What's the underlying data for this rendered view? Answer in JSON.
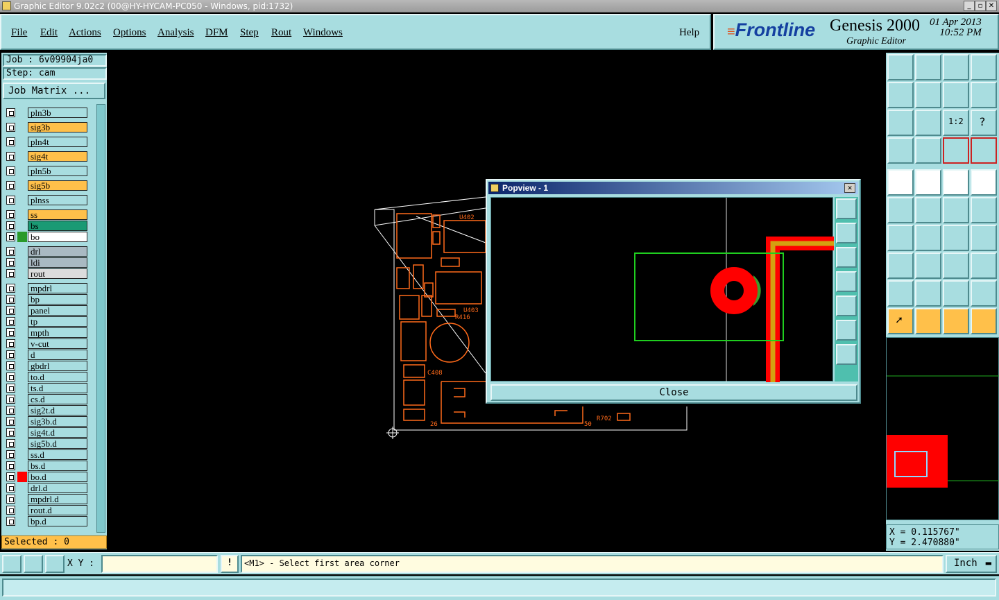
{
  "window": {
    "title": "Graphic Editor 9.02c2 (00@HY-HYCAM-PC050 - Windows, pid:1732)"
  },
  "menu": {
    "items": [
      "File",
      "Edit",
      "Actions",
      "Options",
      "Analysis",
      "DFM",
      "Step",
      "Rout",
      "Windows"
    ],
    "help": "Help"
  },
  "brand": {
    "logo": "Frontline",
    "product": "Genesis 2000",
    "subtitle": "Graphic Editor",
    "date": "01 Apr 2013",
    "time": "10:52 PM"
  },
  "job": {
    "job": "Job : 6v09904ja0",
    "step": "Step: cam",
    "matrix_button": "Job Matrix ..."
  },
  "layers": [
    {
      "name": "pln3b",
      "color": "#a8dde0"
    },
    {
      "name": "sig3b",
      "color": "#ffc04a"
    },
    {
      "name": "pln4t",
      "color": "#a8dde0"
    },
    {
      "name": "sig4t",
      "color": "#ffc04a"
    },
    {
      "name": "pln5b",
      "color": "#a8dde0"
    },
    {
      "name": "sig5b",
      "color": "#ffc04a"
    },
    {
      "name": "plnss",
      "color": "#a8dde0"
    },
    {
      "name": "ss",
      "color": "#ffc04a"
    },
    {
      "name": "bs",
      "color": "#1a9a74"
    },
    {
      "name": "bo",
      "color": "#ffffff",
      "active": true
    },
    {
      "name": "drl",
      "color": "#a9b9c2"
    },
    {
      "name": "ldi",
      "color": "#a9b9c2"
    },
    {
      "name": "rout",
      "color": "#dcdcdc"
    },
    {
      "name": "mpdrl",
      "color": "#a8dde0"
    },
    {
      "name": "bp",
      "color": "#a8dde0"
    },
    {
      "name": "panel",
      "color": "#a8dde0"
    },
    {
      "name": "tp",
      "color": "#a8dde0"
    },
    {
      "name": "mpth",
      "color": "#a8dde0"
    },
    {
      "name": "v-cut",
      "color": "#a8dde0"
    },
    {
      "name": "d",
      "color": "#a8dde0"
    },
    {
      "name": "gbdrl",
      "color": "#a8dde0"
    },
    {
      "name": "to.d",
      "color": "#a8dde0"
    },
    {
      "name": "ts.d",
      "color": "#a8dde0"
    },
    {
      "name": "cs.d",
      "color": "#a8dde0"
    },
    {
      "name": "sig2t.d",
      "color": "#a8dde0"
    },
    {
      "name": "sig3b.d",
      "color": "#a8dde0"
    },
    {
      "name": "sig4t.d",
      "color": "#a8dde0"
    },
    {
      "name": "sig5b.d",
      "color": "#a8dde0"
    },
    {
      "name": "ss.d",
      "color": "#a8dde0"
    },
    {
      "name": "bs.d",
      "color": "#a8dde0"
    },
    {
      "name": "bo.d",
      "color": "#a8dde0",
      "swatch": "#ff0000"
    },
    {
      "name": "drl.d",
      "color": "#a8dde0"
    },
    {
      "name": "mpdrl.d",
      "color": "#a8dde0"
    },
    {
      "name": "rout.d",
      "color": "#a8dde0"
    },
    {
      "name": "bp.d",
      "color": "#a8dde0"
    }
  ],
  "selected": "Selected : 0",
  "popview": {
    "title": "Popview - 1",
    "close": "Close"
  },
  "coords": {
    "x": "X = 0.115767\"",
    "y": "Y = 2.470880\""
  },
  "bottom": {
    "xy_label": "X Y :",
    "xy_value": "",
    "message": "<M1> - Select first area corner",
    "unit": "Inch"
  },
  "pcb_labels": {
    "u402": "U402",
    "u403": "U403",
    "r416": "R416",
    "c408": "C408",
    "r702": "R702",
    "n26": "26",
    "n50": "50"
  }
}
